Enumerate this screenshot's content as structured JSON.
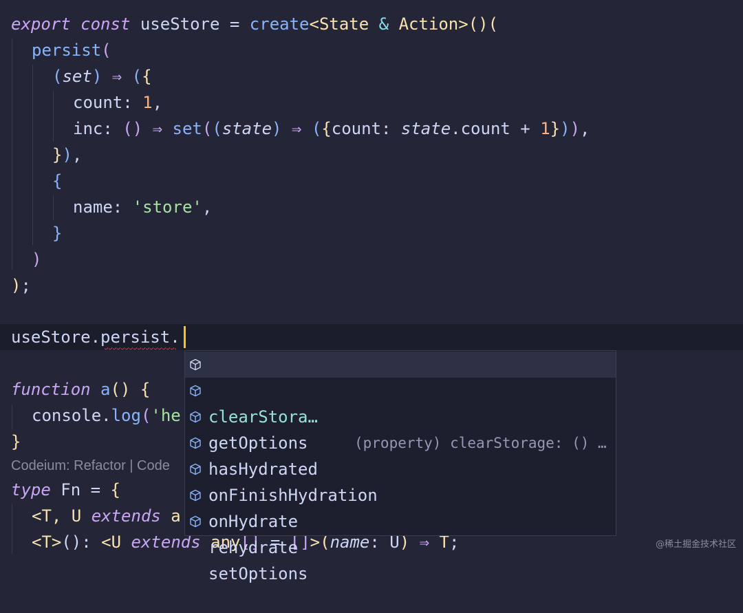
{
  "editor": {
    "lines": {
      "l1": [
        "export",
        " ",
        "const",
        " useStore = ",
        "create",
        "<",
        "State",
        " & ",
        "Action",
        ">",
        "()",
        "("
      ],
      "l2": [
        "persist",
        "("
      ],
      "l3": [
        "(",
        "set",
        ")",
        " ⇒ ",
        "(",
        "{"
      ],
      "l4": [
        "count: ",
        "1",
        ","
      ],
      "l5": [
        "inc: ",
        "()",
        " ⇒ ",
        "set",
        "(",
        "(",
        "state",
        ")",
        " ⇒ ",
        "(",
        "{",
        "count: ",
        "state",
        ".count + ",
        "1",
        "}",
        ")",
        ")",
        ","
      ],
      "l6": [
        "}",
        ")",
        ","
      ],
      "l7": [
        "{"
      ],
      "l8": [
        "name: ",
        "'store'",
        ","
      ],
      "l9": [
        "}"
      ],
      "l10": [
        ")"
      ],
      "l11": [
        ")",
        ";"
      ],
      "l13": [
        "useStore.persist."
      ],
      "l15": [
        "function",
        " ",
        "a",
        "()",
        " ",
        "{"
      ],
      "l16": [
        "console.",
        "log",
        "(",
        "'he"
      ],
      "l17": [
        "}"
      ],
      "l18": [
        "Codeium: Refactor | Code"
      ],
      "l19": [
        "type",
        " Fn = ",
        "{"
      ],
      "l20": [
        "<",
        "T, U ",
        "extends",
        " a"
      ],
      "l21": [
        "<",
        "T",
        ">",
        "(): ",
        "<",
        "U ",
        "extends",
        " ",
        "any",
        "[]",
        " = ",
        "[]",
        ">",
        "(",
        "name",
        ": U",
        ")",
        " ⇒ ",
        "T",
        ";"
      ]
    }
  },
  "autocomplete": {
    "items": [
      {
        "label": "clearStora…",
        "detail": "(property) clearStorage: () …",
        "icon": "cube-icon"
      },
      {
        "label": "getOptions",
        "icon": "cube-icon"
      },
      {
        "label": "hasHydrated",
        "icon": "cube-icon"
      },
      {
        "label": "onFinishHydration",
        "icon": "cube-icon"
      },
      {
        "label": "onHydrate",
        "icon": "cube-icon"
      },
      {
        "label": "rehydrate",
        "icon": "cube-icon"
      },
      {
        "label": "setOptions",
        "icon": "cube-icon"
      }
    ]
  },
  "watermark": "@稀土掘金技术社区",
  "colors": {
    "background": "#242536",
    "keyword": "#cba6f7",
    "function": "#89b4fa",
    "type": "#f9e2af",
    "number": "#fab387",
    "string": "#a6e3a1",
    "cursor": "#f5c518"
  }
}
